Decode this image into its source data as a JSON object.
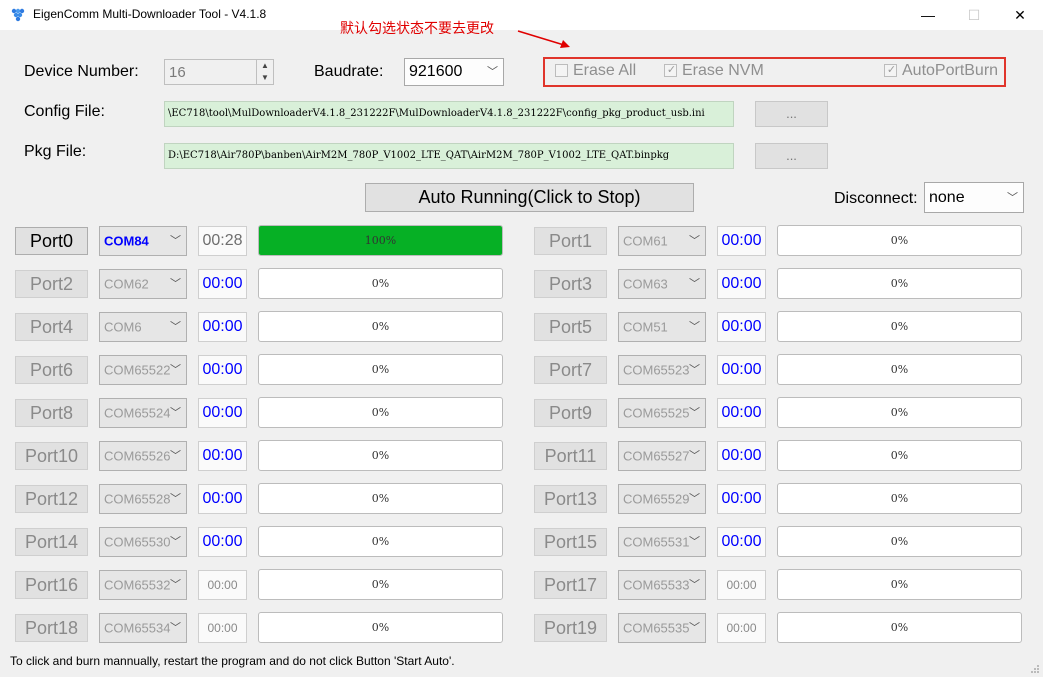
{
  "window": {
    "title": "EigenComm Multi-Downloader Tool - V4.1.8",
    "minimize": "—",
    "maximize": "☐",
    "close": "✕"
  },
  "annotation": "默认勾选状态不要去更改",
  "device": {
    "label": "Device Number:",
    "value": "16"
  },
  "baudrate": {
    "label": "Baudrate:",
    "value": "921600"
  },
  "options": [
    {
      "label": "Erase All",
      "checked": false
    },
    {
      "label": "Erase NVM",
      "checked": true
    },
    {
      "label": "AutoPortBurn",
      "checked": true
    }
  ],
  "config_file": {
    "label": "Config File:",
    "value": "\\EC718\\tool\\MulDownloaderV4.1.8_231222F\\MulDownloaderV4.1.8_231222F\\config_pkg_product_usb.ini",
    "browse": "..."
  },
  "pkg_file": {
    "label": "Pkg File:",
    "value": "D:\\EC718\\Air780P\\banben\\AirM2M_780P_V1002_LTE_QAT\\AirM2M_780P_V1002_LTE_QAT.binpkg",
    "browse": "..."
  },
  "auto_button": "Auto Running(Click to Stop)",
  "disconnect": {
    "label": "Disconnect:",
    "value": "none"
  },
  "ports": [
    {
      "name": "Port0",
      "com": "COM84",
      "time": "00:28",
      "progress": 100,
      "progress_label": "100%",
      "active": true
    },
    {
      "name": "Port1",
      "com": "COM61",
      "time": "00:00",
      "progress": 0,
      "progress_label": "0%"
    },
    {
      "name": "Port2",
      "com": "COM62",
      "time": "00:00",
      "progress": 0,
      "progress_label": "0%"
    },
    {
      "name": "Port3",
      "com": "COM63",
      "time": "00:00",
      "progress": 0,
      "progress_label": "0%"
    },
    {
      "name": "Port4",
      "com": "COM6",
      "time": "00:00",
      "progress": 0,
      "progress_label": "0%"
    },
    {
      "name": "Port5",
      "com": "COM51",
      "time": "00:00",
      "progress": 0,
      "progress_label": "0%"
    },
    {
      "name": "Port6",
      "com": "COM65522",
      "time": "00:00",
      "progress": 0,
      "progress_label": "0%"
    },
    {
      "name": "Port7",
      "com": "COM65523",
      "time": "00:00",
      "progress": 0,
      "progress_label": "0%"
    },
    {
      "name": "Port8",
      "com": "COM65524",
      "time": "00:00",
      "progress": 0,
      "progress_label": "0%"
    },
    {
      "name": "Port9",
      "com": "COM65525",
      "time": "00:00",
      "progress": 0,
      "progress_label": "0%"
    },
    {
      "name": "Port10",
      "com": "COM65526",
      "time": "00:00",
      "progress": 0,
      "progress_label": "0%"
    },
    {
      "name": "Port11",
      "com": "COM65527",
      "time": "00:00",
      "progress": 0,
      "progress_label": "0%"
    },
    {
      "name": "Port12",
      "com": "COM65528",
      "time": "00:00",
      "progress": 0,
      "progress_label": "0%"
    },
    {
      "name": "Port13",
      "com": "COM65529",
      "time": "00:00",
      "progress": 0,
      "progress_label": "0%"
    },
    {
      "name": "Port14",
      "com": "COM65530",
      "time": "00:00",
      "progress": 0,
      "progress_label": "0%"
    },
    {
      "name": "Port15",
      "com": "COM65531",
      "time": "00:00",
      "progress": 0,
      "progress_label": "0%"
    },
    {
      "name": "Port16",
      "com": "COM65532",
      "time": "00:00",
      "progress": 0,
      "progress_label": "0%",
      "idle": true
    },
    {
      "name": "Port17",
      "com": "COM65533",
      "time": "00:00",
      "progress": 0,
      "progress_label": "0%",
      "idle": true
    },
    {
      "name": "Port18",
      "com": "COM65534",
      "time": "00:00",
      "progress": 0,
      "progress_label": "0%",
      "idle": true
    },
    {
      "name": "Port19",
      "com": "COM65535",
      "time": "00:00",
      "progress": 0,
      "progress_label": "0%",
      "idle": true
    }
  ],
  "status_text": "To click and burn mannually, restart the program and do not click Button 'Start Auto'.",
  "colors": {
    "progress_fill": "#06b025",
    "annotation": "#e00000",
    "time_text": "#0000ff"
  },
  "icons": {
    "app": "eigencomm-logo-icon",
    "dropdown": "chevron-down-icon"
  }
}
